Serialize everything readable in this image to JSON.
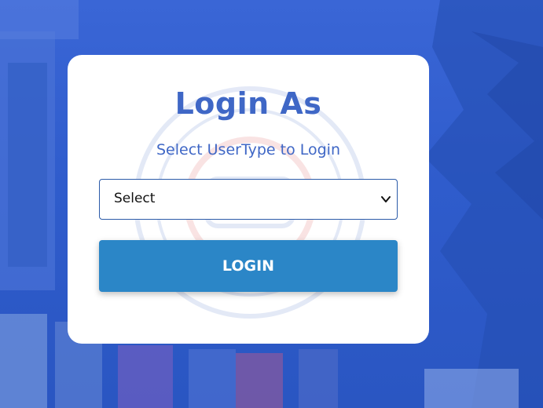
{
  "login": {
    "title": "Login As",
    "subtitle": "Select UserType to Login",
    "select": {
      "selected_value": "Select",
      "icon": "chevron-down-icon"
    },
    "button_label": "LOGIN"
  },
  "colors": {
    "background_overlay": "#2f5ccc",
    "title_text": "#3f67c6",
    "button": "#2b86c7",
    "select_border": "#2b5aa8"
  }
}
